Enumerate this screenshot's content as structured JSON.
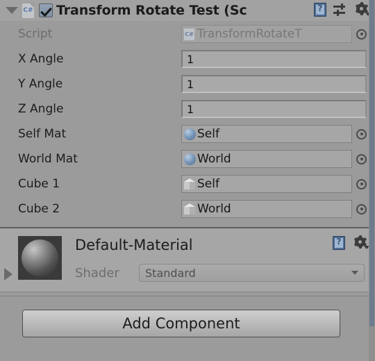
{
  "component": {
    "title": "Transform Rotate Test (Sc",
    "enabled": true,
    "script_icon": "C#",
    "foldout": "expanded",
    "icons": {
      "help": "?",
      "preset": "preset-icon",
      "gear": "gear-icon"
    }
  },
  "properties": [
    {
      "label": "Script",
      "value": "TransformRotateT",
      "type": "object",
      "icon": "cs-script-icon",
      "disabled": true,
      "picker": true
    },
    {
      "label": "X Angle",
      "value": "1",
      "type": "number",
      "icon": "",
      "disabled": false,
      "picker": false
    },
    {
      "label": "Y Angle",
      "value": "1",
      "type": "number",
      "icon": "",
      "disabled": false,
      "picker": false
    },
    {
      "label": "Z Angle",
      "value": "1",
      "type": "number",
      "icon": "",
      "disabled": false,
      "picker": false
    },
    {
      "label": "Self Mat",
      "value": "Self",
      "type": "object",
      "icon": "sphere-icon",
      "disabled": false,
      "picker": true
    },
    {
      "label": "World Mat",
      "value": "World",
      "type": "object",
      "icon": "sphere-icon",
      "disabled": false,
      "picker": true
    },
    {
      "label": "Cube 1",
      "value": "Self",
      "type": "object",
      "icon": "cube-icon",
      "disabled": false,
      "picker": true
    },
    {
      "label": "Cube 2",
      "value": "World",
      "type": "object",
      "icon": "cube-icon",
      "disabled": false,
      "picker": true
    }
  ],
  "material": {
    "name": "Default-Material",
    "shader_label": "Shader",
    "shader_value": "Standard",
    "foldout": "collapsed",
    "preview": "sphere-preview"
  },
  "footer": {
    "add_component_label": "Add Component"
  },
  "colors": {
    "background": "#9b9b9b",
    "header": "#a2a2a2",
    "field": "#a9a9a9",
    "text": "#1c1c1c",
    "dim_text": "#6d6d6d",
    "scrollbar": "#6f7c8e",
    "separator": "#5d5d5d"
  }
}
